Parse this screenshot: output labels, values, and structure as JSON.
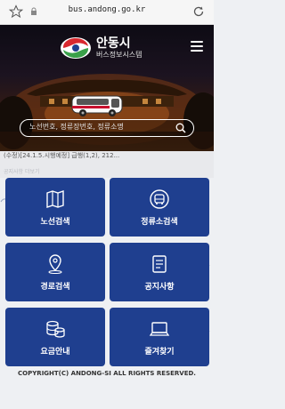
{
  "browser": {
    "url": "bus.andong.go.kr"
  },
  "header": {
    "logo_title": "안동시",
    "logo_subtitle": "버스정보시스템"
  },
  "search": {
    "placeholder": "노선번호, 정류장번호, 정류소명"
  },
  "notice": {
    "text": "(수정)[24.1.5.시행예정] 급행(1,2), 212...",
    "sub": "공지사항 더보기"
  },
  "tiles": [
    {
      "label": "노선검색",
      "icon": "map-icon"
    },
    {
      "label": "정류소검색",
      "icon": "bus-stop-icon"
    },
    {
      "label": "경로검색",
      "icon": "route-pin-icon"
    },
    {
      "label": "공지사항",
      "icon": "notice-icon"
    },
    {
      "label": "요금안내",
      "icon": "coins-icon"
    },
    {
      "label": "즐겨찾기",
      "icon": "laptop-icon"
    }
  ],
  "footer": {
    "copyright": "COPYRIGHT(C) ANDONG-SI ALL RIGHTS RESERVED."
  },
  "colors": {
    "tile": "#1f3f8f",
    "logo_red": "#d9282f",
    "logo_green": "#3aa14a",
    "bus_accent": "#c8102e"
  }
}
